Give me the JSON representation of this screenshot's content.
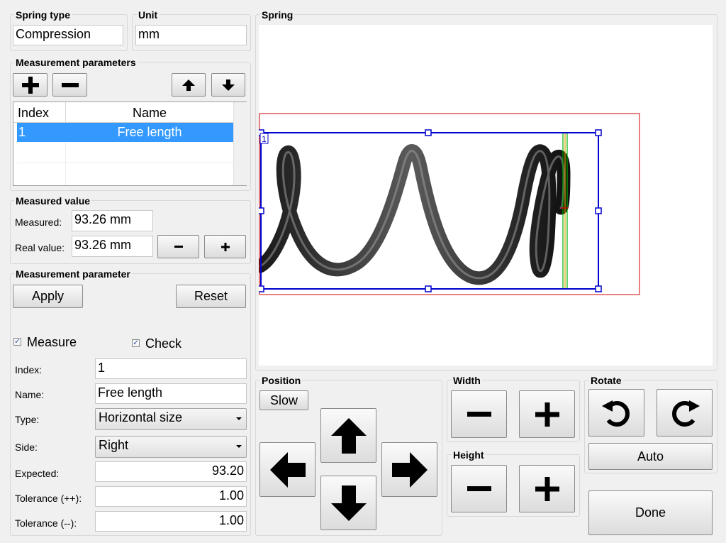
{
  "spring_type": {
    "title": "Spring type",
    "value": "Compression"
  },
  "unit": {
    "title": "Unit",
    "value": "mm"
  },
  "measurement_parameters": {
    "title": "Measurement parameters",
    "columns": [
      "Index",
      "Name"
    ],
    "rows": [
      {
        "index": "1",
        "name": "Free length"
      }
    ],
    "add_icon": "plus-icon",
    "remove_icon": "minus-icon",
    "up_icon": "arrow-up-icon",
    "down_icon": "arrow-down-icon"
  },
  "measured_value": {
    "title": "Measured value",
    "measured_label": "Measured:",
    "measured": "93.26 mm",
    "real_label": "Real value:",
    "real": "93.26 mm"
  },
  "parameter": {
    "title": "Measurement parameter",
    "apply": "Apply",
    "reset": "Reset",
    "measure_label": "Measure",
    "measure_checked": true,
    "check_label": "Check",
    "check_checked": true,
    "index_label": "Index:",
    "index": "1",
    "name_label": "Name:",
    "name": "Free length",
    "type_label": "Type:",
    "type": "Horizontal size",
    "side_label": "Side:",
    "side": "Right",
    "expected_label": "Expected:",
    "expected": "93.20",
    "tol_plus_label": "Tolerance (++):",
    "tol_plus": "1.00",
    "tol_minus_label": "Tolerance (--):",
    "tol_minus": "1.00"
  },
  "spring": {
    "title": "Spring",
    "roi_label": "1",
    "colors": {
      "roi": "#0000cc",
      "outer": "#d00000",
      "green": "#00b000",
      "orange": "#e0a000"
    }
  },
  "position": {
    "title": "Position",
    "slow": "Slow"
  },
  "width": {
    "title": "Width"
  },
  "height": {
    "title": "Height"
  },
  "rotate": {
    "title": "Rotate",
    "auto": "Auto"
  },
  "done": "Done",
  "colors": {
    "selection": "#3399ff",
    "background": "#f0f0f0"
  }
}
